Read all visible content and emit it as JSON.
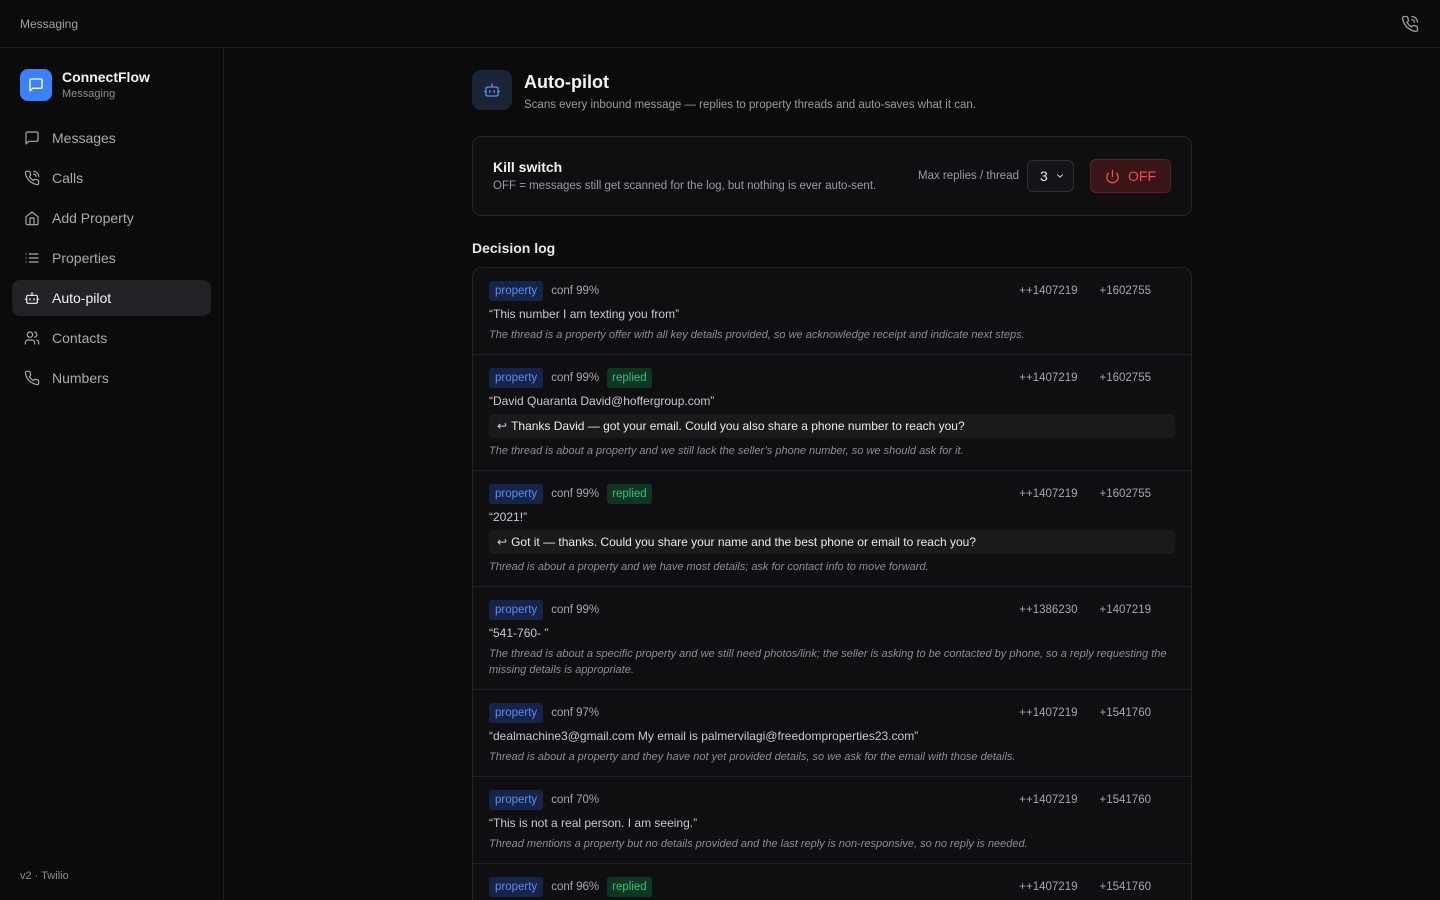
{
  "topbar": {
    "title": "Messaging",
    "call_icon": "phone-call-icon"
  },
  "brand": {
    "name": "ConnectFlow",
    "subtitle": "Messaging"
  },
  "nav": [
    {
      "id": "messages",
      "label": "Messages",
      "icon": "message-icon"
    },
    {
      "id": "calls",
      "label": "Calls",
      "icon": "phone-call-icon"
    },
    {
      "id": "add-property",
      "label": "Add Property",
      "icon": "home-icon"
    },
    {
      "id": "properties",
      "label": "Properties",
      "icon": "list-icon"
    },
    {
      "id": "auto-pilot",
      "label": "Auto-pilot",
      "icon": "bot-icon",
      "active": true
    },
    {
      "id": "contacts",
      "label": "Contacts",
      "icon": "users-icon"
    },
    {
      "id": "numbers",
      "label": "Numbers",
      "icon": "phone-icon"
    }
  ],
  "footer": "v2 · Twilio",
  "header": {
    "title": "Auto-pilot",
    "subtitle": "Scans every inbound message — replies to property threads and auto-saves what it can."
  },
  "kill_switch": {
    "title": "Kill switch",
    "description": "OFF = messages still get scanned for the log, but nothing is ever auto-sent.",
    "max_label": "Max replies / thread",
    "max_value": "3",
    "button_label": "OFF"
  },
  "log": {
    "title": "Decision log",
    "entries": [
      {
        "tag": "property",
        "conf": "conf 99%",
        "replied": "",
        "from": "++1407219",
        "to": "+1602755",
        "quote": "“This number I am texting you from”",
        "reply": "",
        "reason": "The thread is a property offer with all key details provided, so we acknowledge receipt and indicate next steps."
      },
      {
        "tag": "property",
        "conf": "conf 99%",
        "replied": "replied",
        "from": "++1407219",
        "to": "+1602755",
        "quote": "“David Quaranta David@hoffergroup.com”",
        "reply": "Thanks David — got your email. Could you also share a phone number to reach you?",
        "reason": "The thread is about a property and we still lack the seller’s phone number, so we should ask for it."
      },
      {
        "tag": "property",
        "conf": "conf 99%",
        "replied": "replied",
        "from": "++1407219",
        "to": "+1602755",
        "quote": "“2021!”",
        "reply": "Got it — thanks. Could you share your name and the best phone or email to reach you?",
        "reason": "Thread is about a property and we have most details; ask for contact info to move forward."
      },
      {
        "tag": "property",
        "conf": "conf 99%",
        "replied": "",
        "from": "++1386230",
        "to": "+1407219",
        "quote": "“541-760-       ”",
        "reply": "",
        "reason": "The thread is about a specific property and we still need photos/link; the seller is asking to be contacted by phone, so a reply requesting the missing details is appropriate."
      },
      {
        "tag": "property",
        "conf": "conf 97%",
        "replied": "",
        "from": "++1407219",
        "to": "+1541760",
        "quote": "“dealmachine3@gmail.com My email is palmervilagi@freedomproperties23.com”",
        "reply": "",
        "reason": "Thread is about a property and they have not yet provided details, so we ask for the email with those details."
      },
      {
        "tag": "property",
        "conf": "conf 70%",
        "replied": "",
        "from": "++1407219",
        "to": "+1541760",
        "quote": "“This is not a real person. I am seeing.”",
        "reply": "",
        "reason": "Thread mentions a property but no details provided and the last reply is non-responsive, so no reply is needed."
      },
      {
        "tag": "property",
        "conf": "conf 96%",
        "replied": "replied",
        "from": "++1407219",
        "to": "+1541760",
        "quote": "",
        "reply": "",
        "reason": ""
      }
    ]
  }
}
